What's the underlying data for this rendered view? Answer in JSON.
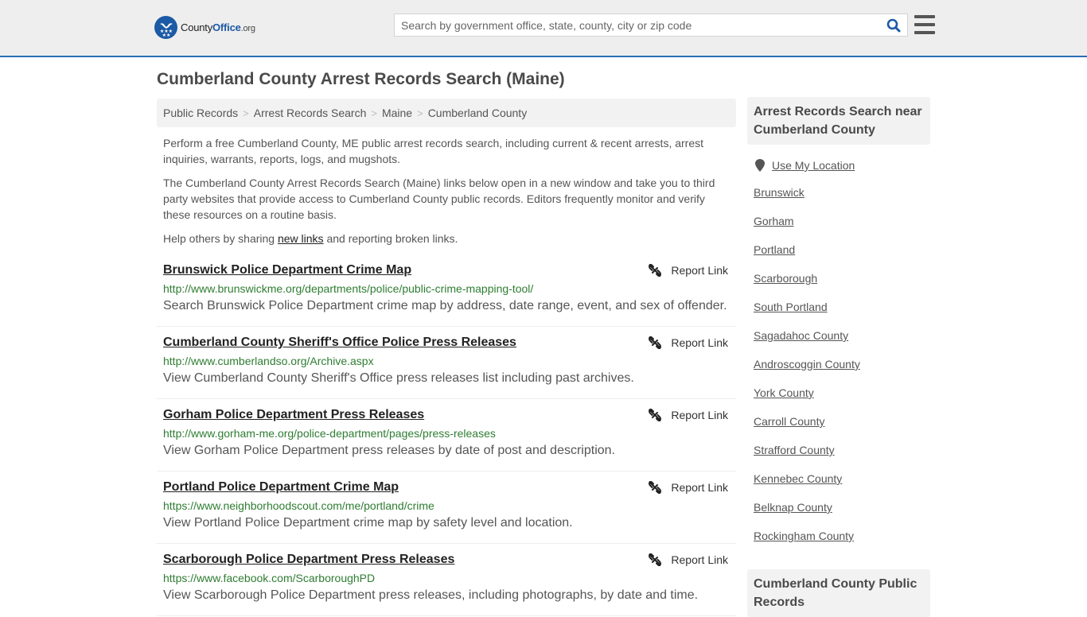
{
  "header": {
    "logo": {
      "name_part1": "County",
      "name_part2": "Office",
      "name_part3": ".org"
    },
    "search_placeholder": "Search by government office, state, county, city or zip code",
    "search_value": "",
    "colors": {
      "brand_blue": "#1c5aa6",
      "header_bg": "#eeeeee",
      "border_accent": "#2a6db5"
    }
  },
  "page": {
    "title": "Cumberland County Arrest Records Search (Maine)",
    "breadcrumb": [
      "Public Records",
      "Arrest Records Search",
      "Maine",
      "Cumberland County"
    ],
    "intro": {
      "p1": "Perform a free Cumberland County, ME public arrest records search, including current & recent arrests, arrest inquiries, warrants, reports, logs, and mugshots.",
      "p2": "The Cumberland County Arrest Records Search (Maine) links below open in a new window and take you to third party websites that provide access to Cumberland County public records. Editors frequently monitor and verify these resources on a routine basis.",
      "p3_before": "Help others by sharing ",
      "p3_link": "new links",
      "p3_after": " and reporting broken links."
    },
    "report_label": "Report Link",
    "results": [
      {
        "title": "Brunswick Police Department Crime Map",
        "url": "http://www.brunswickme.org/departments/police/public-crime-mapping-tool/",
        "desc": "Search Brunswick Police Department crime map by address, date range, event, and sex of offender."
      },
      {
        "title": "Cumberland County Sheriff's Office Police Press Releases",
        "url": "http://www.cumberlandso.org/Archive.aspx",
        "desc": "View Cumberland County Sheriff's Office press releases list including past archives."
      },
      {
        "title": "Gorham Police Department Press Releases",
        "url": "http://www.gorham-me.org/police-department/pages/press-releases",
        "desc": "View Gorham Police Department press releases by date of post and description."
      },
      {
        "title": "Portland Police Department Crime Map",
        "url": "https://www.neighborhoodscout.com/me/portland/crime",
        "desc": "View Portland Police Department crime map by safety level and location."
      },
      {
        "title": "Scarborough Police Department Press Releases",
        "url": "https://www.facebook.com/ScarboroughPD",
        "desc": "View Scarborough Police Department press releases, including photographs, by date and time."
      }
    ]
  },
  "sidebar": {
    "heading": "Arrest Records Search near Cumberland County",
    "use_location": "Use My Location",
    "nearby": [
      "Brunswick",
      "Gorham",
      "Portland",
      "Scarborough",
      "South Portland",
      "Sagadahoc County",
      "Androscoggin County",
      "York County",
      "Carroll County",
      "Strafford County",
      "Kennebec County",
      "Belknap County",
      "Rockingham County"
    ],
    "heading2": "Cumberland County Public Records"
  }
}
